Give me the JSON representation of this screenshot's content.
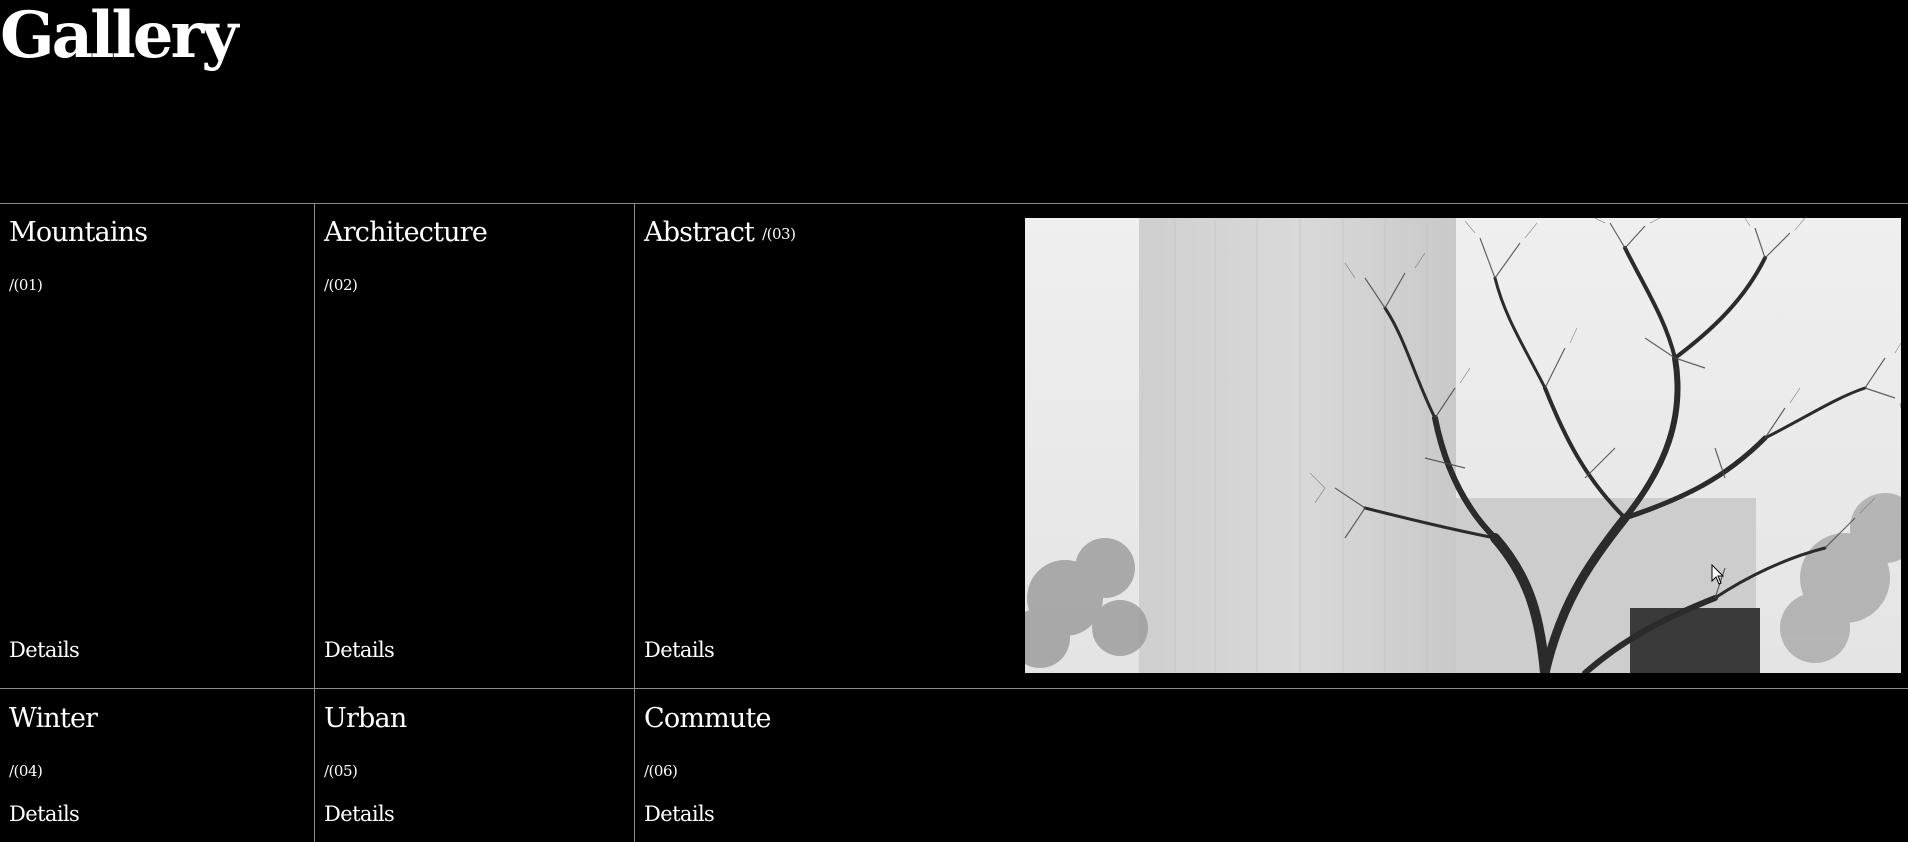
{
  "page": {
    "title": "Gallery"
  },
  "gallery": {
    "items": [
      {
        "title": "Mountains",
        "index": "/(01)",
        "details_label": "Details"
      },
      {
        "title": "Architecture",
        "index": "/(02)",
        "details_label": "Details"
      },
      {
        "title": "Abstract",
        "index": "/(03)",
        "details_label": "Details"
      },
      {
        "title": "Winter",
        "index": "/(04)",
        "details_label": "Details"
      },
      {
        "title": "Urban",
        "index": "/(05)",
        "details_label": "Details"
      },
      {
        "title": "Commute",
        "index": "/(06)",
        "details_label": "Details"
      }
    ]
  },
  "preview": {
    "description_icon": "bare-tree-concrete-building-photo"
  },
  "colors": {
    "background": "#000000",
    "text": "#ffffff",
    "divider": "#8a8a8a"
  }
}
